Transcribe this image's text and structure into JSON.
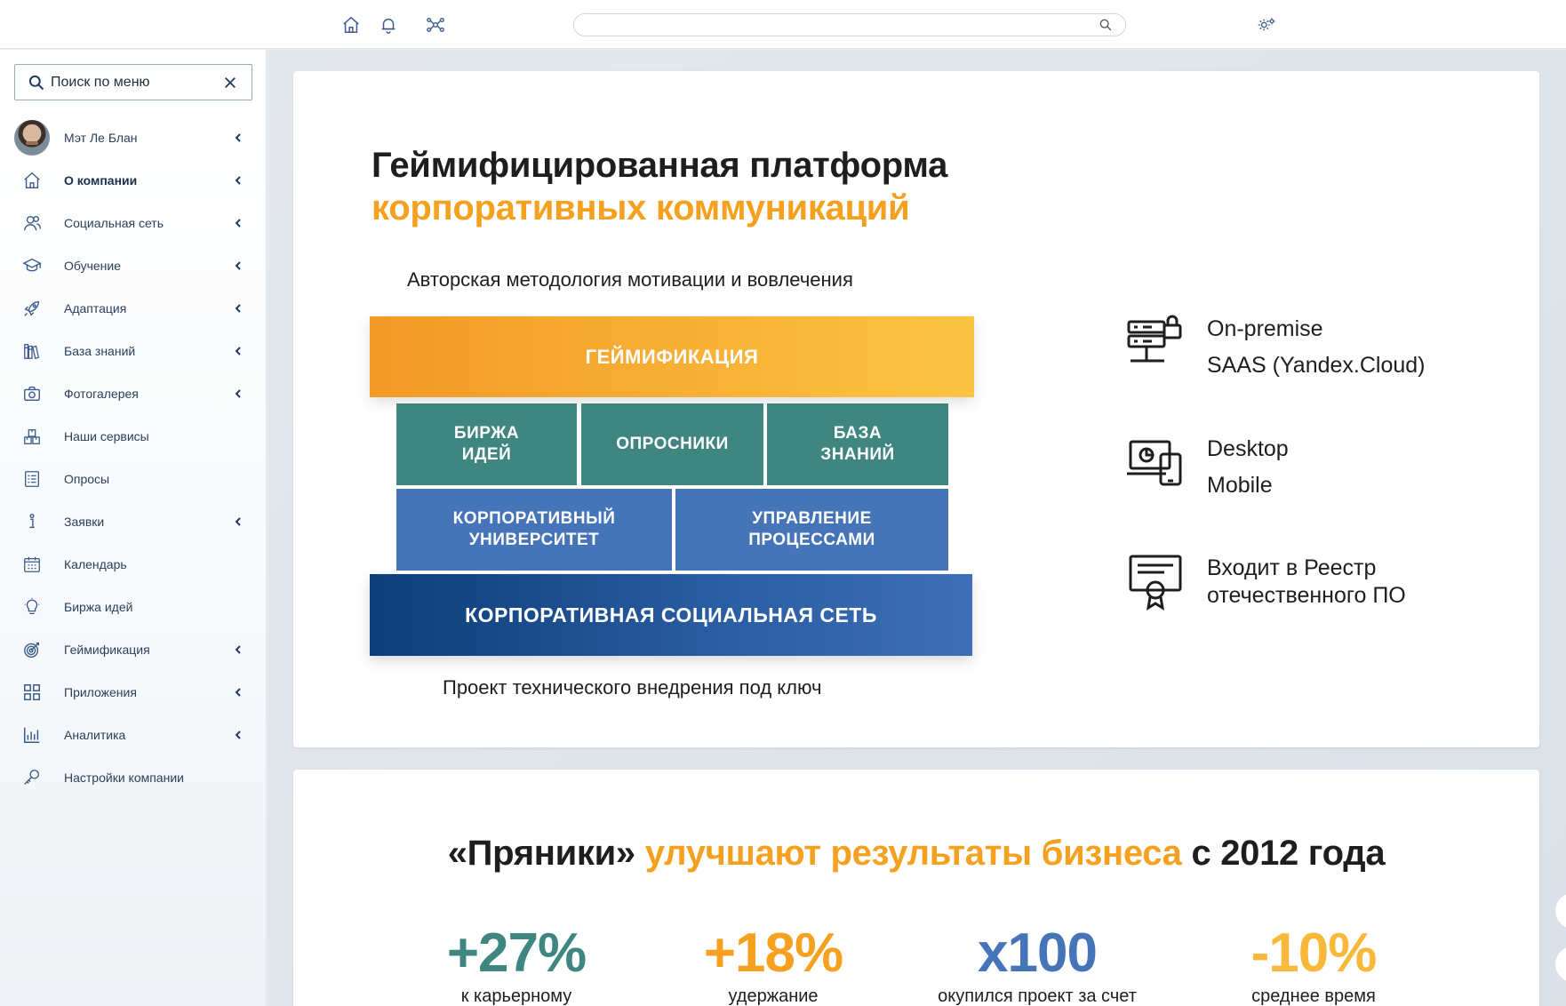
{
  "search": {
    "placeholder": ""
  },
  "menu_search": {
    "placeholder": "Поиск по меню"
  },
  "sidebar": {
    "items": [
      {
        "label": "Мэт Ле Блан",
        "icon": "avatar",
        "chevron": true
      },
      {
        "label": "О компании",
        "icon": "home-icon",
        "chevron": true,
        "active": true
      },
      {
        "label": "Социальная сеть",
        "icon": "users-icon",
        "chevron": true
      },
      {
        "label": "Обучение",
        "icon": "graduation-cap-icon",
        "chevron": true
      },
      {
        "label": "Адаптация",
        "icon": "rocket-icon",
        "chevron": true
      },
      {
        "label": "База знаний",
        "icon": "books-icon",
        "chevron": true
      },
      {
        "label": "Фотогалерея",
        "icon": "camera-icon",
        "chevron": true
      },
      {
        "label": "Наши сервисы",
        "icon": "boxes-icon",
        "chevron": false
      },
      {
        "label": "Опросы",
        "icon": "checklist-icon",
        "chevron": false
      },
      {
        "label": "Заявки",
        "icon": "info-icon",
        "chevron": true
      },
      {
        "label": "Календарь",
        "icon": "calendar-icon",
        "chevron": false
      },
      {
        "label": "Биржа идей",
        "icon": "lightbulb-icon",
        "chevron": false
      },
      {
        "label": "Геймификация",
        "icon": "target-icon",
        "chevron": true
      },
      {
        "label": "Приложения",
        "icon": "grid-icon",
        "chevron": true
      },
      {
        "label": "Аналитика",
        "icon": "bar-chart-icon",
        "chevron": true
      },
      {
        "label": "Настройки компании",
        "icon": "key-icon",
        "chevron": false
      }
    ]
  },
  "hero": {
    "title_line1": "Геймифицированная платформа",
    "title_line2": "корпоративных коммуникаций",
    "methodology": "Авторская методология мотивации и вовлечения",
    "gamification": "ГЕЙМИФИКАЦИЯ",
    "ideas_1": "БИРЖА",
    "ideas_2": "ИДЕЙ",
    "surveys": "ОПРОСНИКИ",
    "kb_1": "БАЗА",
    "kb_2": "ЗНАНИЙ",
    "uni_1": "КОРПОРАТИВНЫЙ",
    "uni_2": "УНИВЕРСИТЕТ",
    "proc_1": "УПРАВЛЕНИЕ",
    "proc_2": "ПРОЦЕССАМИ",
    "social": "КОРПОРАТИВНАЯ СОЦИАЛЬНАЯ СЕТЬ",
    "turnkey": "Проект технического внедрения под ключ"
  },
  "features": [
    {
      "line1": "On-premise",
      "line2": "SAAS (Yandex.Cloud)",
      "icon": "server-lock-icon"
    },
    {
      "line1": "Desktop",
      "line2": "Mobile",
      "icon": "devices-icon"
    },
    {
      "line1": "Входит в Реестр",
      "line2": "отечественного ПО",
      "icon": "certificate-icon"
    }
  ],
  "results": {
    "title_a": "«Пряники»",
    "title_b": "улучшают результаты бизнеса",
    "title_c": "с 2012 года",
    "stats": [
      {
        "value": "+27%",
        "desc": "к карьерному"
      },
      {
        "value": "+18%",
        "desc": "удержание"
      },
      {
        "value": "x100",
        "desc": "окупился проект за счет"
      },
      {
        "value": "-10%",
        "desc": "среднее время"
      }
    ]
  },
  "colors": {
    "orange": "#f5a11f",
    "teal": "#3f8681",
    "blue": "#4574b8",
    "navy": "#0d3e78",
    "icon": "#3a5a8c"
  }
}
